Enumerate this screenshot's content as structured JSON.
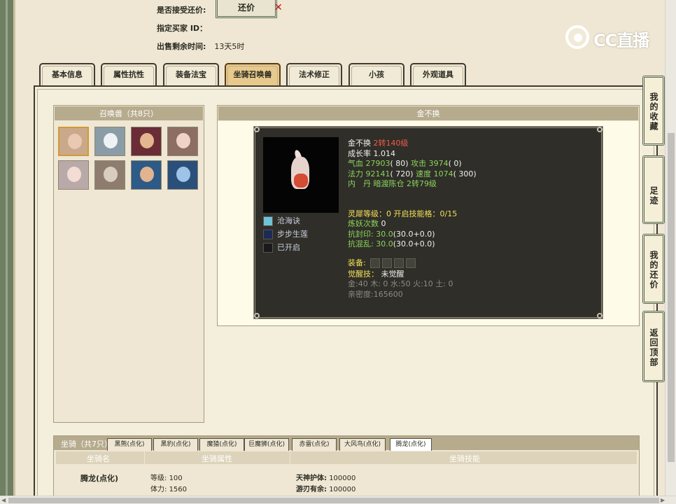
{
  "top_info": {
    "accept_counter_label": "是否接受还价:",
    "counter_button": "还价",
    "buyer_id_label": "指定买家 ID：",
    "remaining_time_label": "出售剩余时间:",
    "remaining_time_value": "13天5时"
  },
  "logo": {
    "text": "CC直播"
  },
  "tabs": [
    {
      "label": "基本信息"
    },
    {
      "label": "属性抗性"
    },
    {
      "label": "装备法宝"
    },
    {
      "label": "坐骑召唤兽"
    },
    {
      "label": "法术修正"
    },
    {
      "label": "小孩"
    },
    {
      "label": "外观道具"
    }
  ],
  "active_tab": 3,
  "summon": {
    "header": "召唤兽（共8只）",
    "count": 8
  },
  "pet_detail": {
    "header": "金不换",
    "name": "金不换",
    "level": "2转140级",
    "growth_label": "成长率",
    "growth": "1.014",
    "hp_label": "气血",
    "hp": "27903",
    "hp_bonus": "( 80)",
    "atk_label": "攻击",
    "atk": "3974",
    "atk_bonus": "( 0)",
    "mp_label": "法力",
    "mp": "92141",
    "mp_bonus": "( 720)",
    "spd_label": "速度",
    "spd": "1074",
    "spd_bonus": "( 300)",
    "neidan_label": "内　丹",
    "neidan": "暗渡陈仓 2转79级",
    "spirit_line": "灵犀等级：0 开启技能格：0/15",
    "refine_label": "炼妖次数",
    "refine": "0",
    "resist_seal_label": "抗封印:",
    "resist_seal": "30.0",
    "resist_seal_detail": "(30.0+0.0)",
    "resist_chaos_label": "抗混乱:",
    "resist_chaos": "30.0",
    "resist_chaos_detail": "(30.0+0.0)",
    "equip_label": "装备:",
    "awaken_label": "觉醒技：",
    "awaken": "未觉醒",
    "elements": "金:40 木: 0 水:50 火:10 土: 0",
    "intimacy": "亲密度:165600",
    "skills": [
      {
        "label": "沧海诀"
      },
      {
        "label": "步步生莲"
      },
      {
        "label": "已开启"
      }
    ]
  },
  "mount": {
    "title": "坐骑（共7只）",
    "tabs": [
      {
        "label": "黑熊(点化)"
      },
      {
        "label": "黑豹(点化)"
      },
      {
        "label": "魔猿(点化)"
      },
      {
        "label": "巨魔狮(点化)"
      },
      {
        "label": "赤雷(点化)"
      },
      {
        "label": "大风鸟(点化)"
      },
      {
        "label": "腾龙(点化)"
      }
    ],
    "active_tab": 6,
    "col_name": "坐骑名",
    "col_attr": "坐骑属性",
    "col_skill": "坐骑技能",
    "row_name": "腾龙(点化)",
    "level_label": "等级:",
    "level": "100",
    "stamina_label": "体力:",
    "stamina": "1560",
    "skill1_label": "天神护体:",
    "skill1": "100000",
    "skill2_label": "游刃有余:",
    "skill2": "100000"
  },
  "sidebar": [
    {
      "label": "我的收藏"
    },
    {
      "label": "足迹"
    },
    {
      "label": "我的还价"
    },
    {
      "label": "返回顶部"
    }
  ],
  "colors": {
    "frame_green": "#6f7f62",
    "tab_active": "#e8c98c",
    "card_dark": "#2f2e28",
    "header_tan": "#b6ab8d"
  }
}
